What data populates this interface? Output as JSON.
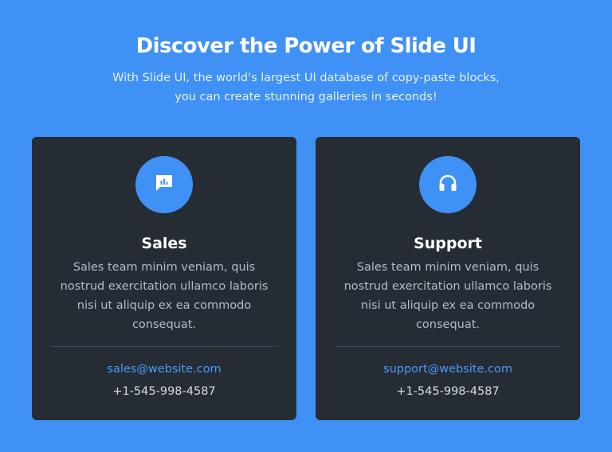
{
  "hero": {
    "title": "Discover the Power of Slide UI",
    "subtitle": "With Slide UI, the world's largest UI database of copy-paste blocks, you can create stunning galleries in seconds!"
  },
  "cards": [
    {
      "icon": "chat-chart-icon",
      "title": "Sales",
      "description": "Sales team minim veniam, quis nostrud exercitation ullamco laboris nisi ut aliquip ex ea commodo consequat.",
      "email": "sales@website.com",
      "phone": "+1-545-998-4587"
    },
    {
      "icon": "headphones-icon",
      "title": "Support",
      "description": "Sales team minim veniam, quis nostrud exercitation ullamco laboris nisi ut aliquip ex ea commodo consequat.",
      "email": "support@website.com",
      "phone": "+1-545-998-4587"
    }
  ],
  "colors": {
    "background": "#3f91f6",
    "card": "#252c34",
    "accent": "#3f91f6",
    "link": "#4a9af8"
  }
}
